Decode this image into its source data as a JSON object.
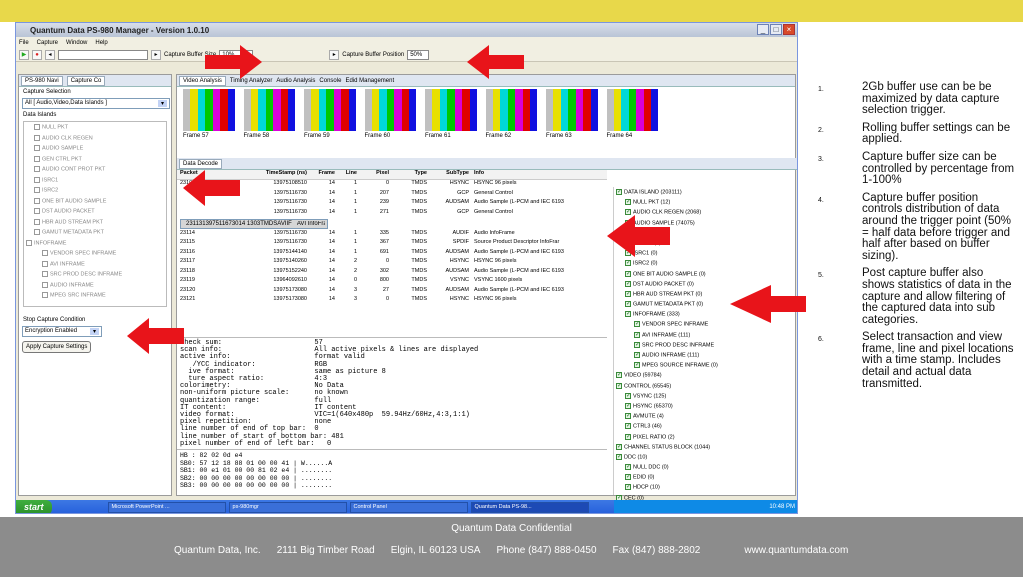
{
  "window": {
    "title": "Quantum Data PS-980 Manager - Version 1.0.10",
    "menu": [
      "File",
      "Capture",
      "Window",
      "Help"
    ],
    "toolbar": {
      "buffer_size_label": "Capture Buffer Size",
      "buffer_size_value": "10%",
      "buffer_position_label": "Capture Buffer Position",
      "buffer_position_value": "50%"
    }
  },
  "left_panel": {
    "tabs": [
      "PS-980 Navi",
      "Capture Co"
    ],
    "capture_selection_label": "Capture Selection",
    "capture_selection_value": "All [ Audio,Video,Data Islands ]",
    "data_islands_label": "Data Islands",
    "data_islands": [
      "NULL PKT",
      "AUDIO CLK REGEN",
      "AUDIO SAMPLE",
      "GEN CTRL PKT",
      "AUDIO CONT PROT PKT",
      "ISRC1",
      "ISRC2",
      "ONE BIT AUDIO SAMPLE",
      "DST AUDIO PACKET",
      "HBR AUD STREAM PKT",
      "GAMUT METADATA PKT",
      "INFOFRAME",
      "VENDOR SPEC INFRAME",
      "AVI INFRAME",
      "SRC PROD DESC INFRAME",
      "AUDIO INFRAME",
      "MPEG SRC INFRAME"
    ],
    "stop_condition_label": "Stop Capture Condition",
    "stop_condition_value": "Encryption Enabled",
    "apply_button": "Apply Capture Settings"
  },
  "right_panel": {
    "tabs": [
      "Video Analysis",
      "Timing Analyzer",
      "Audio Analysis",
      "Console",
      "Edid Management"
    ],
    "frames": [
      "Frame 57",
      "Frame 58",
      "Frame 59",
      "Frame 60",
      "Frame 61",
      "Frame 62",
      "Frame 63",
      "Frame 64"
    ],
    "decode_title": "Data Decode",
    "columns": [
      "Packet",
      "TimeStamp (ns)",
      "Frame",
      "Line",
      "Pixel",
      "Type",
      "SubType",
      "Info"
    ],
    "rows": [
      [
        "23109",
        "13975108510",
        "14",
        "1",
        "0",
        "TMDS",
        "HSYNC",
        "HSYNC 96 pixels"
      ],
      [
        "",
        "13975116730",
        "14",
        "1",
        "207",
        "TMDS",
        "GCP",
        "General Control"
      ],
      [
        "",
        "13975116730",
        "14",
        "1",
        "239",
        "TMDS",
        "AUDSAM",
        "Audio Sample (L-PCM and IEC 6193"
      ],
      [
        "",
        "13975116730",
        "14",
        "1",
        "271",
        "TMDS",
        "GCP",
        "General Control"
      ],
      [
        "23113",
        "13975116730",
        "14",
        "1",
        "303",
        "TMDS",
        "AVIIF",
        "AVI InfoFrame"
      ],
      [
        "23114",
        "13975116730",
        "14",
        "1",
        "335",
        "TMDS",
        "AUDIF",
        "Audio InfoFrame"
      ],
      [
        "23115",
        "13975116730",
        "14",
        "1",
        "367",
        "TMDS",
        "SPDIF",
        "Source Product Descriptor InfoFrar"
      ],
      [
        "23116",
        "13975144140",
        "14",
        "1",
        "691",
        "TMDS",
        "AUDSAM",
        "Audio Sample (L-PCM and IEC 6193"
      ],
      [
        "23117",
        "13975140260",
        "14",
        "2",
        "0",
        "TMDS",
        "HSYNC",
        "HSYNC 96 pixels"
      ],
      [
        "23118",
        "13975152240",
        "14",
        "2",
        "302",
        "TMDS",
        "AUDSAM",
        "Audio Sample (L-PCM and IEC 6193"
      ],
      [
        "23119",
        "13964092610",
        "14",
        "0",
        "800",
        "TMDS",
        "VSYNC",
        "VSYNC 1600 pixels"
      ],
      [
        "23120",
        "13975173080",
        "14",
        "3",
        "27",
        "TMDS",
        "AUDSAM",
        "Audio Sample (L-PCM and IEC 6193"
      ],
      [
        "23121",
        "13975173080",
        "14",
        "3",
        "0",
        "TMDS",
        "HSYNC",
        "HSYNC 96 pixels"
      ]
    ],
    "details": "check sum:                      57\nscan info:                      All active pixels & lines are displayed\nactive info:                    format valid\n   /YCC indicator:              RGB\n  ive format:                   same as picture 8\n  ture aspect ratio:            4:3\ncolorimetry:                    No Data\nnon-uniform picture scale:      no known\nquantization range:             full\nIT content:                     IT content\nvideo format:                   VIC=1(640x480p  59.94Hz/60Hz,4:3,1:1)\npixel repetition:               none\nline number of end of top bar:  0\nline number of start of bottom bar: 481\npixel number of end of left bar:   0",
    "hex": "HB : 82 02 0d e4\nSB0: 57 12 18 88 01 00 00 41 | W......A\nSB1: 00 e1 01 00 00 81 02 e4 | ........\nSB2: 00 00 00 00 00 00 00 00 | ........\nSB3: 00 00 00 00 00 00 00 00 | ........",
    "tree": [
      "DATA ISLAND (203111)",
      "NULL PKT (12)",
      "AUDIO CLK REGEN (2068)",
      "AUDIO SAMPLE (74075)",
      "(248)",
      "OT PKT (0)",
      "ISRC1 (0)",
      "ISRC2 (0)",
      "ONE BIT AUDIO SAMPLE (0)",
      "DST AUDIO PACKET (0)",
      "HBR AUD STREAM PKT (0)",
      "GAMUT METADATA PKT (0)",
      "INFOFRAME (333)",
      "VENDOR SPEC INFRAME",
      "AVI INFRAME (111)",
      "SRC PROD DESC INFRAME",
      "AUDIO INFRAME (111)",
      "MPEG SOURCE INFRAME (0)",
      "VIDEO (59784)",
      "CONTROL (65545)",
      "VSYNC (125)",
      "HSYNC (65370)",
      "AVMUTE (4)",
      "CTRL3 (46)",
      "PIXEL RATIO (2)",
      "CHANNEL STATUS BLOCK (1044)",
      "DDC (10)",
      "NULL DDC (0)",
      "EDID (0)",
      "HDCP (10)",
      "CEC (0)",
      "HPD (0)"
    ]
  },
  "taskbar": {
    "start": "start",
    "tasks": [
      "Microsoft PowerPoint ...",
      "ps-980mgr",
      "Control Panel",
      "Quantum Data PS-98..."
    ],
    "clock": "10:48 PM"
  },
  "notes": [
    {
      "num": "1.",
      "text": "2Gb buffer use can be be maximized by data capture selection trigger."
    },
    {
      "num": "2.",
      "text": "Rolling buffer settings can be applied."
    },
    {
      "num": "3.",
      "text": "Capture buffer size can be controlled by percentage from 1-100%"
    },
    {
      "num": "4.",
      "text": "Capture buffer position controls distribution of data around the trigger point (50% = half data before trigger and half after based on buffer sizing)."
    },
    {
      "num": "5.",
      "text": "Post capture buffer also shows statistics of data in the capture and allow filtering of the captured data into sub categories."
    },
    {
      "num": "6.",
      "text": "Select transaction and view frame, line and pixel locations with a time stamp.  Includes detail and actual data transmitted."
    }
  ],
  "footer": {
    "confidential": "Quantum Data Confidential",
    "company": "Quantum Data, Inc.",
    "address": "2111 Big Timber Road",
    "city": "Elgin, IL 60123  USA",
    "phone": "Phone (847) 888-0450",
    "fax": "Fax (847) 888-2802",
    "web": "www.quantumdata.com"
  },
  "colors": {
    "arrow": "#e8141a",
    "band": "#e8d84a",
    "footer": "#8c8c8c"
  }
}
